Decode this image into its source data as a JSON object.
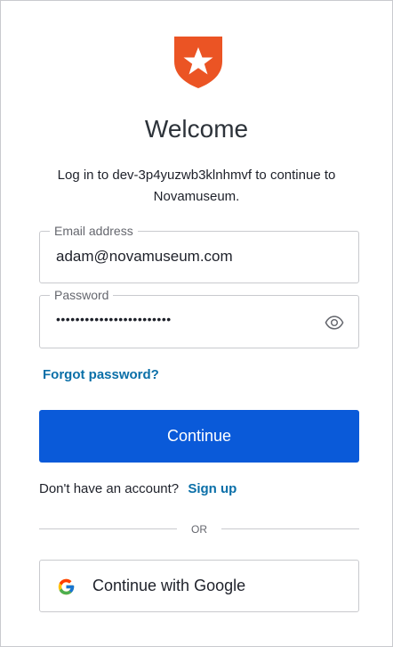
{
  "header": {
    "title": "Welcome",
    "subtitle": "Log in to dev-3p4yuzwb3klnhmvf to continue to Novamuseum."
  },
  "form": {
    "email": {
      "label": "Email address",
      "value": "adam@novamuseum.com"
    },
    "password": {
      "label": "Password",
      "value": "••••••••••••••••••••••••",
      "toggle_icon": "eye-icon"
    },
    "forgot_label": "Forgot password?",
    "continue_label": "Continue"
  },
  "signup": {
    "prompt": "Don't have an account?",
    "link": "Sign up"
  },
  "divider": {
    "label": "OR"
  },
  "social": {
    "google_label": "Continue with Google",
    "icon": "google-icon"
  },
  "colors": {
    "primary": "#0a5ad9",
    "link": "#0a6fa8",
    "logo": "#eb5424"
  }
}
